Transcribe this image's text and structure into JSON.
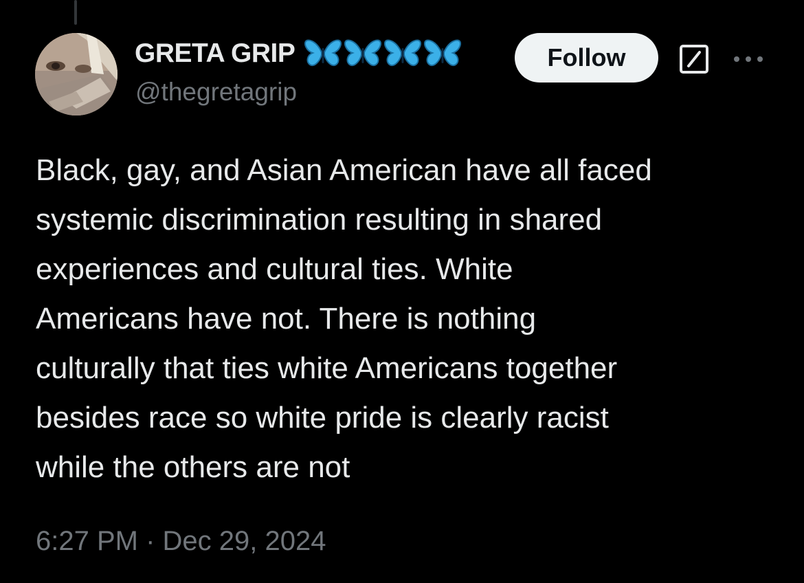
{
  "tweet": {
    "author": {
      "display_name": "GRETA GRIP",
      "handle": "@thegretagrip",
      "name_emoji": [
        "butterfly-icon",
        "butterfly-icon",
        "butterfly-icon",
        "butterfly-icon"
      ]
    },
    "follow_label": "Follow",
    "text_lines": [
      "Black, gay, and Asian American have all faced",
      "systemic discrimination resulting in shared",
      "experiences and cultural ties. White",
      "Americans have not. There is nothing",
      "culturally that ties white Americans together",
      "besides race so white pride is clearly racist",
      "while the others are not"
    ],
    "time": "6:27 PM",
    "separator": "·",
    "date": "Dec 29, 2024"
  },
  "colors": {
    "background": "#000000",
    "primary_text": "#e7e9ea",
    "secondary_text": "#71767b",
    "follow_bg": "#eff3f4",
    "butterfly": "#3bb0e8"
  }
}
